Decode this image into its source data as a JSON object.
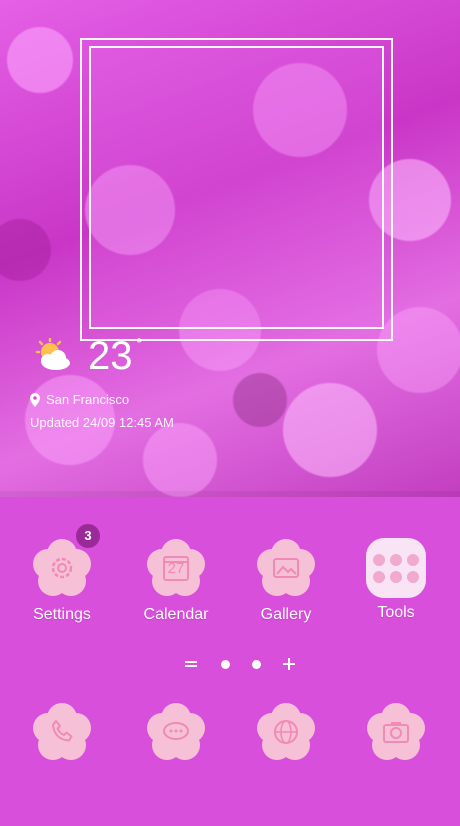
{
  "colors": {
    "background": "#d84fdc",
    "icon_bg": "#f6c1d6",
    "icon_fg": "#f08ab6",
    "badge": "#9a2a97"
  },
  "weather": {
    "temperature": "23",
    "degree_symbol": "°",
    "icon": "partly-sunny-icon",
    "location": "San Francisco",
    "updated": "Updated 24/09 12:45 AM"
  },
  "apps": [
    {
      "label": "Settings",
      "icon": "gear-icon",
      "badge": "3"
    },
    {
      "label": "Calendar",
      "icon": "calendar-icon",
      "day": "27"
    },
    {
      "label": "Gallery",
      "icon": "picture-icon"
    },
    {
      "label": "Tools",
      "icon": "folder-grid-icon"
    }
  ],
  "page_indicator": {
    "pages": 2,
    "current": 1
  },
  "dock": [
    {
      "icon": "phone-icon"
    },
    {
      "icon": "message-icon"
    },
    {
      "icon": "globe-icon"
    },
    {
      "icon": "camera-icon"
    }
  ]
}
